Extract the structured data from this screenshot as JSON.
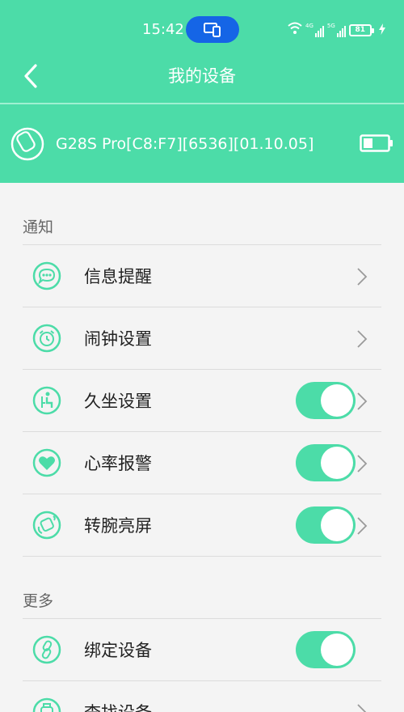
{
  "status_bar": {
    "time": "15:42",
    "network_1": "4G",
    "network_2": "5G",
    "battery": "81",
    "icons": [
      "phone-link-icon",
      "wifi-icon",
      "signal-icon",
      "battery-icon",
      "charging-icon"
    ]
  },
  "nav": {
    "title": "我的设备",
    "back_icon": "back-arrow-icon"
  },
  "device": {
    "name": "G28S Pro[C8:F7][6536][01.10.05]",
    "icon": "watch-icon",
    "battery_icon": "battery-low-icon"
  },
  "sections": [
    {
      "header": "通知",
      "items": [
        {
          "label": "信息提醒",
          "icon": "message-icon",
          "control": "chevron"
        },
        {
          "label": "闹钟设置",
          "icon": "alarm-clock-icon",
          "control": "chevron"
        },
        {
          "label": "久坐设置",
          "icon": "sedentary-icon",
          "control": "toggle",
          "on": true
        },
        {
          "label": "心率报警",
          "icon": "heart-icon",
          "control": "toggle",
          "on": true
        },
        {
          "label": "转腕亮屏",
          "icon": "wrist-turn-icon",
          "control": "toggle",
          "on": true
        }
      ]
    },
    {
      "header": "更多",
      "items": [
        {
          "label": "绑定设备",
          "icon": "link-icon",
          "control": "toggle",
          "on": true
        },
        {
          "label": "查找设备",
          "icon": "find-device-icon",
          "control": "chevron"
        }
      ]
    }
  ],
  "colors": {
    "accent": "#4cdca8",
    "status_pill": "#1565e6",
    "background": "#f4f4f4"
  }
}
